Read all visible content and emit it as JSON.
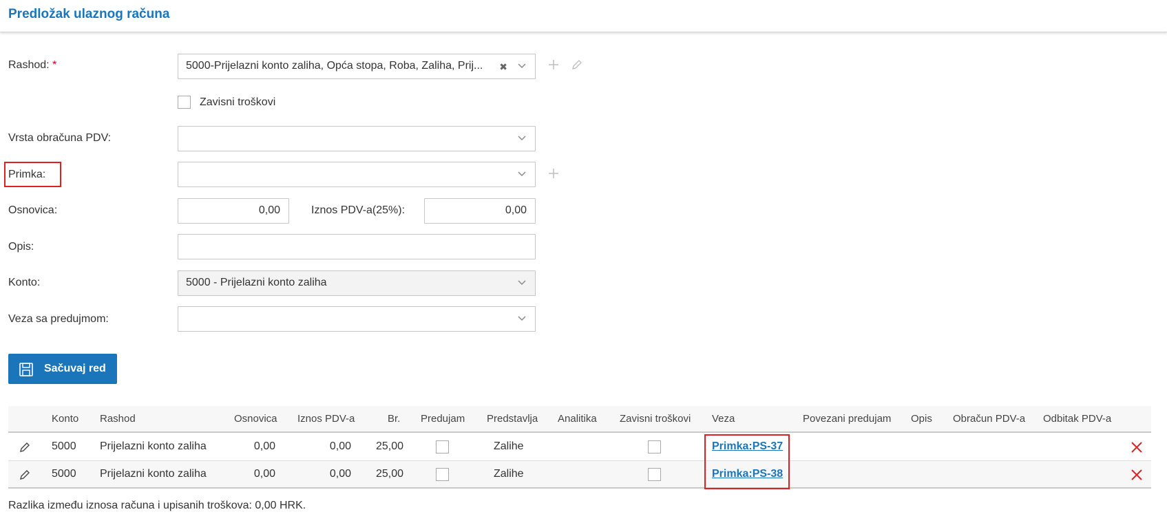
{
  "header": {
    "title": "Predložak ulaznog računa"
  },
  "form": {
    "rashod": {
      "label": "Rashod:",
      "required_mark": "*",
      "value": "5000-Prijelazni konto zaliha, Opća stopa, Roba, Zaliha, Prij..."
    },
    "zavisni": {
      "label": "Zavisni troškovi",
      "checked": false
    },
    "vrsta": {
      "label": "Vrsta obračuna PDV:",
      "value": ""
    },
    "primka": {
      "label": "Primka:",
      "value": ""
    },
    "osnovica": {
      "label": "Osnovica:",
      "value": "0,00"
    },
    "iznos_pdv": {
      "label": "Iznos PDV-a(25%):",
      "value": "0,00"
    },
    "opis": {
      "label": "Opis:",
      "value": ""
    },
    "konto": {
      "label": "Konto:",
      "value": "5000 - Prijelazni konto zaliha"
    },
    "veza": {
      "label": "Veza sa predujmom:",
      "value": ""
    },
    "save_label": "Sačuvaj red"
  },
  "table": {
    "columns": [
      "Konto",
      "Rashod",
      "Osnovica",
      "Iznos PDV-a",
      "Br.",
      "Predujam",
      "Predstavlja",
      "Analitika",
      "Zavisni troškovi",
      "Veza",
      "Povezani predujam",
      "Opis",
      "Obračun PDV-a",
      "Odbitak PDV-a"
    ],
    "rows": [
      {
        "konto": "5000",
        "rashod": "Prijelazni konto zaliha",
        "osnovica": "0,00",
        "iznos_pdv": "0,00",
        "br": "25,00",
        "predujam": false,
        "predstavlja": "Zalihe",
        "zavisni": false,
        "veza": "Primka:PS-37"
      },
      {
        "konto": "5000",
        "rashod": "Prijelazni konto zaliha",
        "osnovica": "0,00",
        "iznos_pdv": "0,00",
        "br": "25,00",
        "predujam": false,
        "predstavlja": "Zalihe",
        "zavisni": false,
        "veza": "Primka:PS-38"
      }
    ]
  },
  "footer": {
    "note": "Razlika između iznosa računa i upisanih troškova: 0,00 HRK."
  },
  "colors": {
    "accent": "#1b75bb",
    "highlight": "#e02020",
    "delete": "#e02020"
  },
  "icons": [
    "plus-icon",
    "pencil-icon",
    "chevron-down-icon",
    "clear-icon",
    "save-icon",
    "delete-icon"
  ]
}
